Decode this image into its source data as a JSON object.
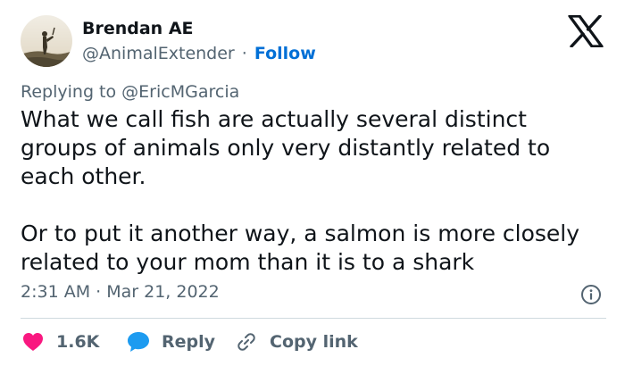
{
  "author": {
    "display_name": "Brendan AE",
    "handle": "@AnimalExtender",
    "separator": "·",
    "follow_label": "Follow"
  },
  "reply_context": {
    "prefix": "Replying to",
    "mention": "@EricMGarcia"
  },
  "tweet": {
    "paragraph_1": "What we call fish are actually several distinct groups of animals only very distantly related to each other.",
    "paragraph_2": "Or to put it another way, a salmon is more closely related to your mom than it is to a shark",
    "timestamp": "2:31 AM · Mar 21, 2022"
  },
  "actions": {
    "like_count": "1.6K",
    "reply_label": "Reply",
    "copy_link_label": "Copy link"
  },
  "icons": {
    "logo": "x-logo-icon",
    "info": "info-icon",
    "like": "heart-icon",
    "reply": "speech-bubble-icon",
    "copy": "link-icon"
  },
  "colors": {
    "text_primary": "#0f1419",
    "text_secondary": "#536471",
    "link": "#006fd6",
    "like": "#f91880",
    "reply": "#1d9bf0",
    "divider": "#cfd9de"
  }
}
